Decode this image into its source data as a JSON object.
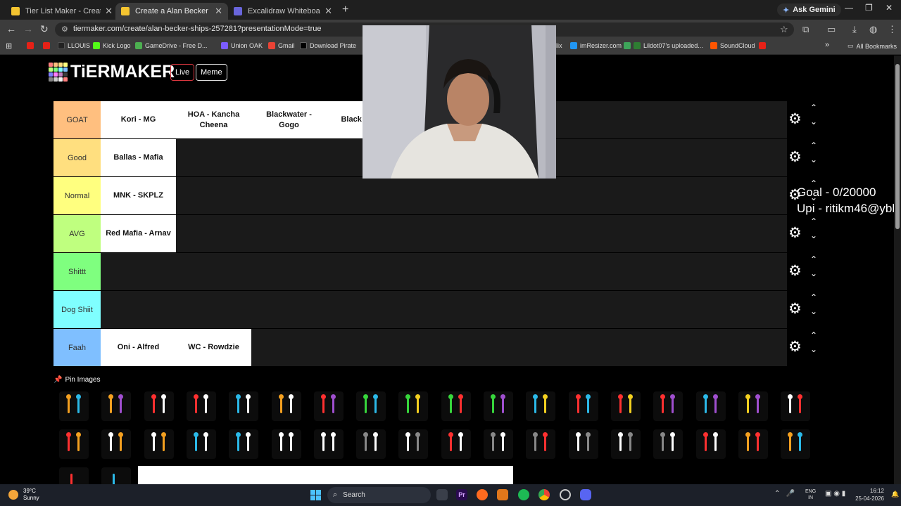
{
  "browser": {
    "tabs": [
      {
        "title": "Tier List Maker - Create a Tier L",
        "color": "#f4c430"
      },
      {
        "title": "Create a Alan Becker Ships Tier",
        "color": "#f4c430"
      },
      {
        "title": "Excalidraw Whiteboard",
        "color": "#6965db"
      }
    ],
    "new_tab": "+",
    "ask_gemini": "Ask Gemini",
    "url": "tiermaker.com/create/alan-becker-ships-257281?presentationMode=true",
    "bookmarks": [
      {
        "label": "",
        "color": "#e62117"
      },
      {
        "label": "",
        "color": "#e62117"
      },
      {
        "label": "LLOUIS",
        "color": "#222222"
      },
      {
        "label": "Kick Logo",
        "color": "#53fc18"
      },
      {
        "label": "GameDrive - Free D...",
        "color": "#4caf50"
      },
      {
        "label": "Union OAK",
        "color": "#7b5cff"
      },
      {
        "label": "Gmail",
        "color": "#ea4335"
      },
      {
        "label": "Download Pirate",
        "color": "#000000"
      },
      {
        "label": "imResizer.com",
        "color": "#2196f3"
      },
      {
        "label": "Lildot07's uploaded...",
        "color": "#3ea55a"
      },
      {
        "label": "SoundCloud",
        "color": "#ff5500"
      },
      {
        "label": "",
        "color": "#e62117"
      }
    ],
    "partial_bookmark": "lix",
    "all_bookmarks": "All Bookmarks"
  },
  "site": {
    "logo_text": "TiERMAKER",
    "logo_colors": [
      "#ff7f7f",
      "#ffbf7f",
      "#ffdf7f",
      "#ffff7f",
      "#bfff7f",
      "#7fff7f",
      "#7fffff",
      "#7fbfff",
      "#7f7fff",
      "#ff7fff",
      "#bf7fbf",
      "#3b3b3b",
      "#858585",
      "#cfcfcf",
      "#f7f7f7",
      "#ff7f7f"
    ],
    "live_label": "Live",
    "meme_label": "Meme",
    "live_color": "#d9363e",
    "meme_color": "#dddddd"
  },
  "tiers": [
    {
      "label": "GOAT",
      "color": "#ffbf7f",
      "items": [
        "Kori - MG",
        "HOA - Kancha Cheena",
        "Blackwater - Gogo",
        "Black Kanch"
      ]
    },
    {
      "label": "Good",
      "color": "#ffdf7f",
      "items": [
        "Ballas - Mafia"
      ]
    },
    {
      "label": "Normal",
      "color": "#ffff7f",
      "items": [
        "MNK - SKPLZ"
      ]
    },
    {
      "label": "AVG",
      "color": "#bfff7f",
      "items": [
        "Red Mafia - Arnav"
      ]
    },
    {
      "label": "Shittt",
      "color": "#7fff7f",
      "items": []
    },
    {
      "label": "Dog Shiit",
      "color": "#7fffff",
      "items": []
    },
    {
      "label": "Faah",
      "color": "#7fbfff",
      "items": [
        "Oni - Alfred",
        "WC - Rowdzie"
      ]
    }
  ],
  "controls": {
    "gear_icon": "⚙",
    "up_icon": "⌃",
    "down_icon": "⌄"
  },
  "pin_images": {
    "label": "Pin Images"
  },
  "overlay": {
    "goal": "Goal - 0/20000",
    "upi": "Upi - ritikm46@ybl"
  },
  "thumb_colors": [
    [
      "#f4a020",
      "#2bb9e8"
    ],
    [
      "#f4a020",
      "#a04fcf"
    ],
    [
      "#ff3030",
      "#ffffff"
    ],
    [
      "#ff3030",
      "#ffffff"
    ],
    [
      "#2bb9e8",
      "#ffffff"
    ],
    [
      "#f4a020",
      "#ffffff"
    ],
    [
      "#ff3030",
      "#a04fcf"
    ],
    [
      "#37d63c",
      "#2bb9e8"
    ],
    [
      "#37d63c",
      "#f4d020"
    ],
    [
      "#37d63c",
      "#ff3030"
    ],
    [
      "#37d63c",
      "#a04fcf"
    ],
    [
      "#2bb9e8",
      "#f4d020"
    ],
    [
      "#ff3030",
      "#2bb9e8"
    ],
    [
      "#ff3030",
      "#f4d020"
    ],
    [
      "#ff3030",
      "#a04fcf"
    ],
    [
      "#2bb9e8",
      "#a04fcf"
    ],
    [
      "#f4d020",
      "#a04fcf"
    ],
    [
      "#ffffff",
      "#ff3030"
    ],
    [
      "#ff3030",
      "#f4a020"
    ],
    [
      "#ffffff",
      "#f4a020"
    ],
    [
      "#ffffff",
      "#f4a020"
    ],
    [
      "#2bb9e8",
      "#ffffff"
    ],
    [
      "#2bb9e8",
      "#ffffff"
    ],
    [
      "#ffffff",
      "#ffffff"
    ],
    [
      "#ffffff",
      "#ffffff"
    ],
    [
      "#888888",
      "#ffffff"
    ],
    [
      "#ffffff",
      "#888888"
    ],
    [
      "#ff3030",
      "#ffffff"
    ],
    [
      "#888888",
      "#ffffff"
    ],
    [
      "#888888",
      "#ff3030"
    ],
    [
      "#ffffff",
      "#888888"
    ],
    [
      "#ffffff",
      "#888888"
    ],
    [
      "#888888",
      "#ffffff"
    ],
    [
      "#ff3030",
      "#ffffff"
    ],
    [
      "#f4a020",
      "#ff3030"
    ],
    [
      "#f4a020",
      "#2bb9e8"
    ],
    [
      "#ff30ff",
      "#ff30ff"
    ]
  ],
  "taskbar": {
    "temp": "39°C",
    "weather": "Sunny",
    "search": "Search",
    "lang1": "ENG",
    "lang2": "IN",
    "time": "16:12",
    "date": "25-04-2026"
  }
}
